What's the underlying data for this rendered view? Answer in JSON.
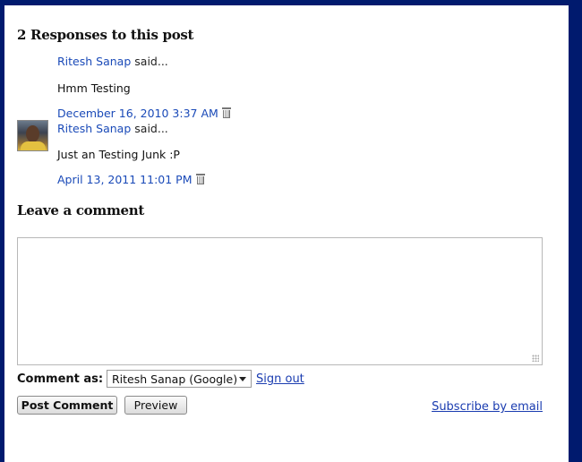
{
  "comments_section": {
    "heading": "2 Responses to this post",
    "comments": [
      {
        "author": "Ritesh Sanap",
        "said": "said...",
        "body": "Hmm Testing",
        "timestamp": "December 16, 2010 3:37 AM",
        "has_avatar": false
      },
      {
        "author": "Ritesh Sanap",
        "said": "said...",
        "body": "Just an Testing Junk :P",
        "timestamp": "April 13, 2011 11:01 PM",
        "has_avatar": true
      }
    ]
  },
  "comment_form": {
    "heading": "Leave a comment",
    "textarea_value": "",
    "comment_as_label": "Comment as:",
    "identity_selected": "Ritesh Sanap (Google)",
    "sign_out_label": "Sign out",
    "post_button_label": "Post Comment",
    "preview_button_label": "Preview",
    "subscribe_label": "Subscribe by email"
  },
  "colors": {
    "frame": "#001a6e",
    "link": "#1a4ab8",
    "underlined_link": "#1a3cb0"
  },
  "icons": {
    "delete": "trash-icon",
    "select_arrow": "chevron-down-icon",
    "resize": "resize-grip-icon"
  }
}
